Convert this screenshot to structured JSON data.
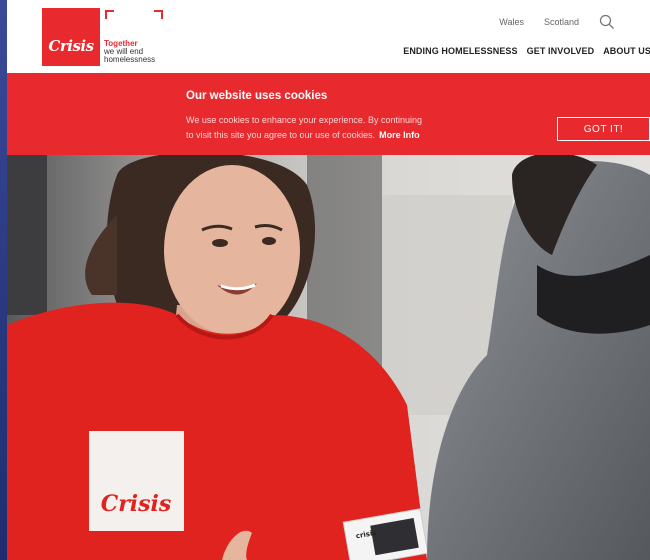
{
  "header": {
    "logo_text": "Crisis",
    "tagline": [
      "Together",
      "we will end",
      "homelessness"
    ],
    "util_links": [
      "Wales",
      "Scotland"
    ],
    "nav": [
      "ENDING HOMELESSNESS",
      "GET INVOLVED",
      "ABOUT US"
    ]
  },
  "cookie": {
    "title": "Our website uses cookies",
    "line1": "We use cookies to enhance your experience. By continuing",
    "line2": "to visit this site you agree to our use of cookies.",
    "more": "More Info",
    "button": "GOT IT!"
  },
  "hero": {
    "shirt_text": "Crisis",
    "leaflet_text": "crisis"
  },
  "colors": {
    "brand_red": "#e8292d",
    "desktop_blue": "#2c3c86"
  }
}
